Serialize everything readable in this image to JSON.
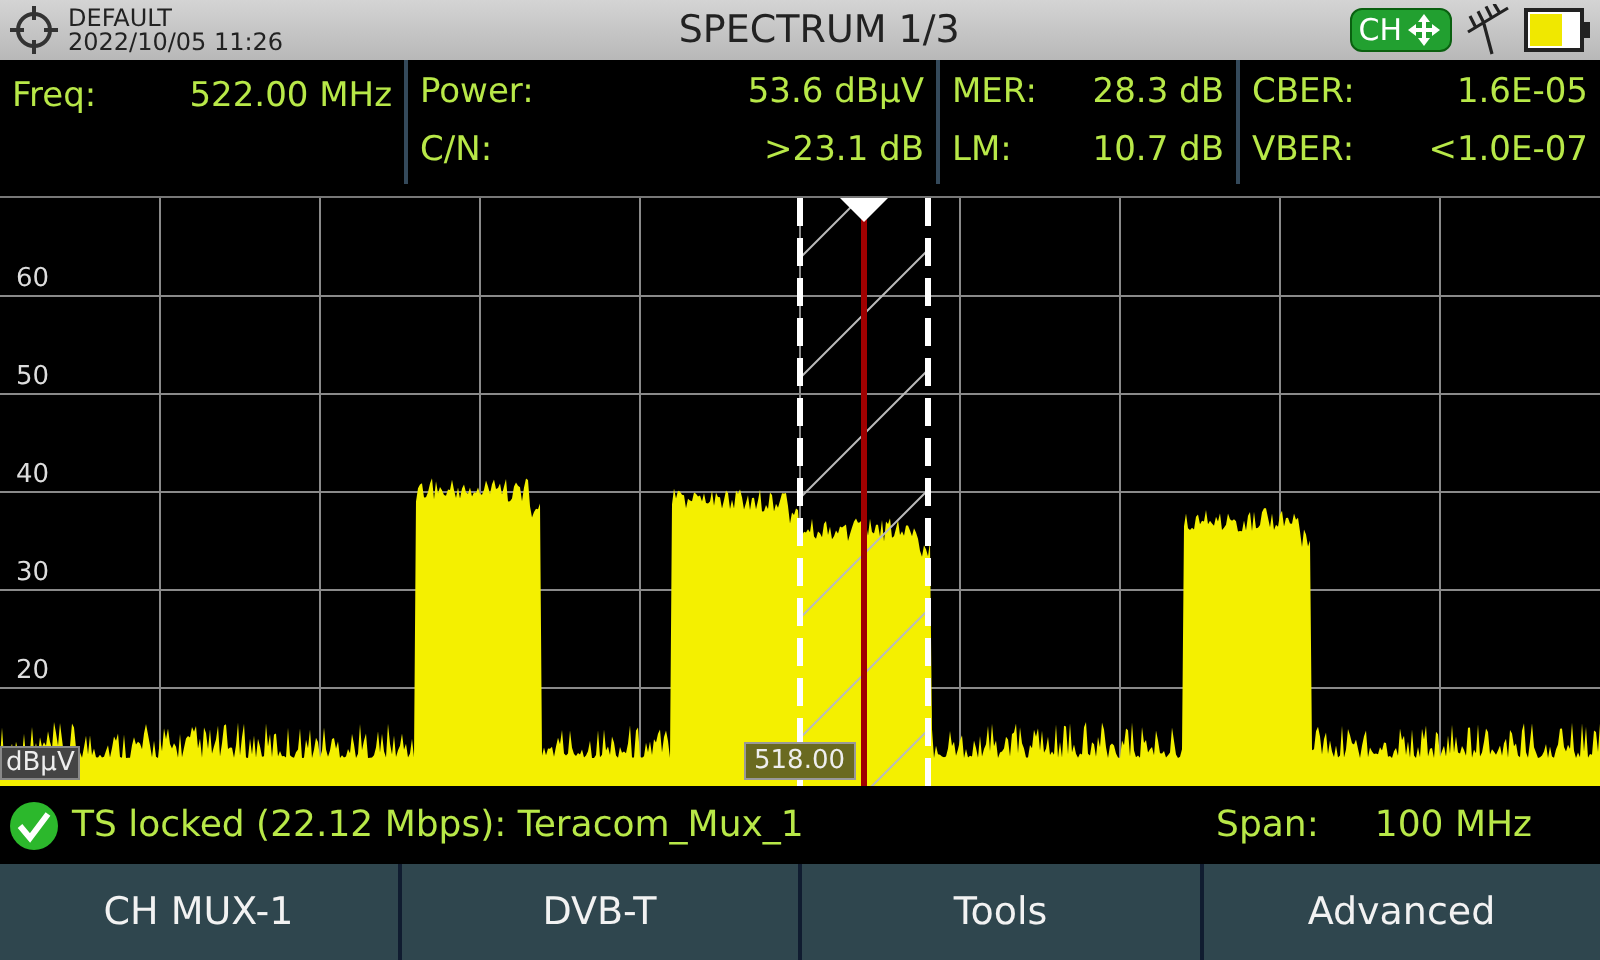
{
  "header": {
    "profile": "DEFAULT",
    "datetime": "2022/10/05 11:26",
    "title": "SPECTRUM 1/3",
    "ch_badge": "CH"
  },
  "measurements": [
    [
      {
        "label": "Freq:",
        "value": "522.00 MHz"
      }
    ],
    [
      {
        "label": "Power:",
        "value": "53.6 dBµV"
      },
      {
        "label": "C/N:",
        "value": ">23.1 dB"
      }
    ],
    [
      {
        "label": "MER:",
        "value": "28.3 dB"
      },
      {
        "label": "LM:",
        "value": "10.7 dB"
      }
    ],
    [
      {
        "label": "CBER:",
        "value": "1.6E-05"
      },
      {
        "label": "VBER:",
        "value": "<1.0E-07"
      }
    ]
  ],
  "spectrum": {
    "y_axis_labels": [
      "60",
      "50",
      "40",
      "30",
      "20"
    ],
    "unit": "dBµV",
    "marker_frequency": "518.00"
  },
  "status": {
    "locked": true,
    "message": "TS locked (22.12 Mbps): Teracom_Mux_1",
    "span_label": "Span:",
    "span_value": "100 MHz"
  },
  "softkeys": [
    "CH MUX-1",
    "DVB-T",
    "Tools",
    "Advanced"
  ]
}
